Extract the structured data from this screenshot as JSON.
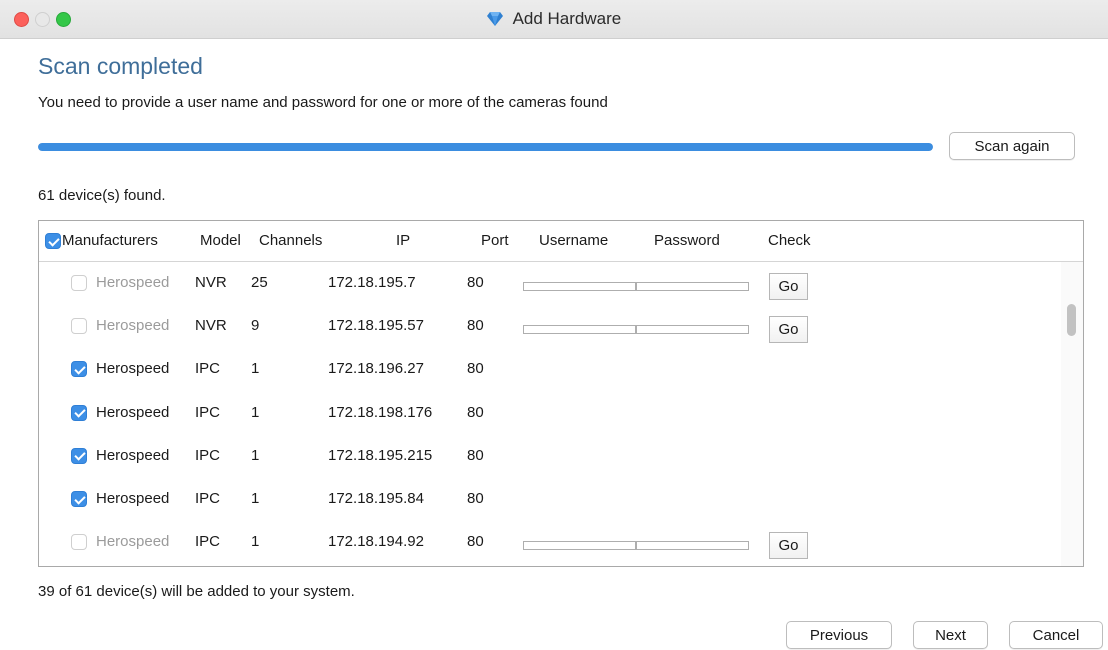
{
  "window": {
    "title": "Add Hardware"
  },
  "heading": "Scan completed",
  "subtext": "You need to provide a user name and password for one or more of the cameras found",
  "progress": {
    "fraction": 1.0
  },
  "scan_again_label": "Scan again",
  "found_text": "61 device(s) found.",
  "table": {
    "columns": {
      "manufacturers": "Manufacturers",
      "model": "Model",
      "channels": "Channels",
      "ip": "IP",
      "port": "Port",
      "username": "Username",
      "password": "Password",
      "check": "Check"
    },
    "header_checked": true,
    "rows": [
      {
        "checked": false,
        "manufacturer": "Herospeed",
        "model": "NVR",
        "channels": "25",
        "ip": "172.18.195.7",
        "port": "80",
        "needs_credentials": true,
        "go_label": "Go"
      },
      {
        "checked": false,
        "manufacturer": "Herospeed",
        "model": "NVR",
        "channels": "9",
        "ip": "172.18.195.57",
        "port": "80",
        "needs_credentials": true,
        "go_label": "Go"
      },
      {
        "checked": true,
        "manufacturer": "Herospeed",
        "model": "IPC",
        "channels": "1",
        "ip": "172.18.196.27",
        "port": "80",
        "needs_credentials": false
      },
      {
        "checked": true,
        "manufacturer": "Herospeed",
        "model": "IPC",
        "channels": "1",
        "ip": "172.18.198.176",
        "port": "80",
        "needs_credentials": false
      },
      {
        "checked": true,
        "manufacturer": "Herospeed",
        "model": "IPC",
        "channels": "1",
        "ip": "172.18.195.215",
        "port": "80",
        "needs_credentials": false
      },
      {
        "checked": true,
        "manufacturer": "Herospeed",
        "model": "IPC",
        "channels": "1",
        "ip": "172.18.195.84",
        "port": "80",
        "needs_credentials": false
      },
      {
        "checked": false,
        "manufacturer": "Herospeed",
        "model": "IPC",
        "channels": "1",
        "ip": "172.18.194.92",
        "port": "80",
        "needs_credentials": true,
        "go_label": "Go"
      }
    ]
  },
  "summary_text": "39 of 61 device(s) will be added to your system.",
  "buttons": {
    "previous": "Previous",
    "next": "Next",
    "cancel": "Cancel"
  },
  "colors": {
    "accent": "#3b8de0",
    "heading": "#3f6e99",
    "checkbox": "#3d8fe6"
  }
}
